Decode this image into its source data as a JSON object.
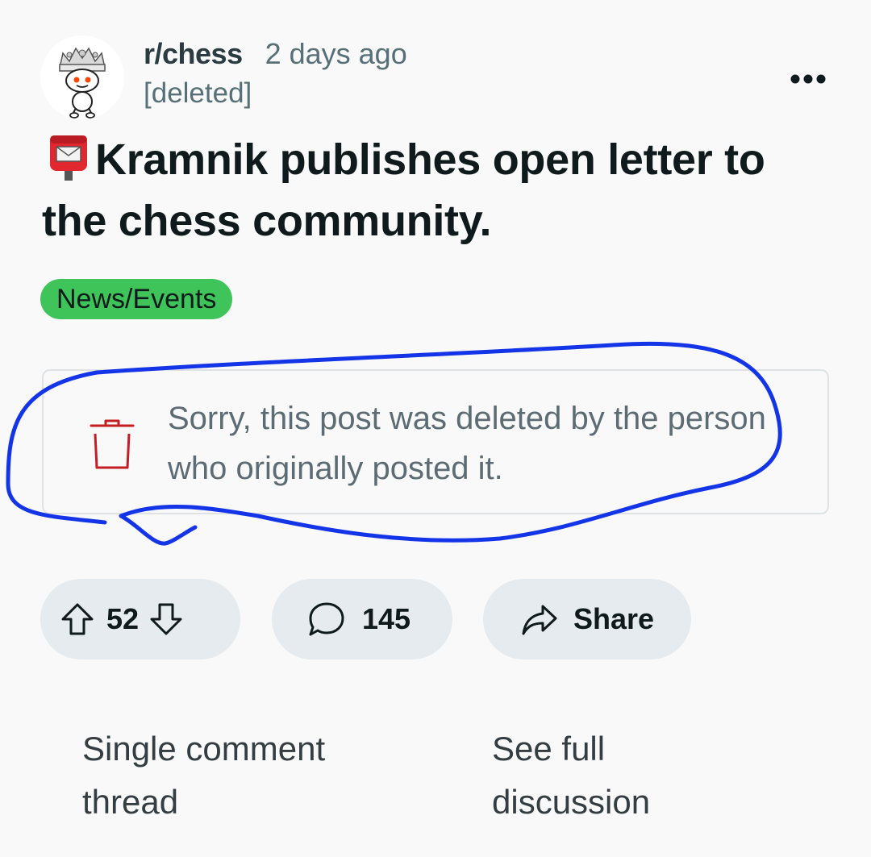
{
  "post": {
    "subreddit": "r/chess",
    "age": "2 days ago",
    "author": "[deleted]",
    "title": "Kramnik publishes open letter to the chess community.",
    "title_emoji": "postbox-emoji",
    "flair": "News/Events",
    "deleted_notice": "Sorry, this post was deleted by the person who originally posted it."
  },
  "actions": {
    "score": "52",
    "comments": "145",
    "share_label": "Share"
  },
  "footer": {
    "single_thread": "Single comment thread",
    "full_discussion": "See full discussion"
  },
  "icons": {
    "avatar": "subreddit-avatar-icon",
    "more": "more-options-icon",
    "upvote": "upvote-arrow-icon",
    "downvote": "downvote-arrow-icon",
    "comment": "comment-bubble-icon",
    "share": "share-arrow-icon",
    "trash": "trash-icon"
  },
  "colors": {
    "flair_bg": "#3ec459",
    "trash_red": "#c41e24",
    "scribble_blue": "#1434e8",
    "pill_bg": "#e5ebee",
    "muted_text": "#576f76"
  }
}
